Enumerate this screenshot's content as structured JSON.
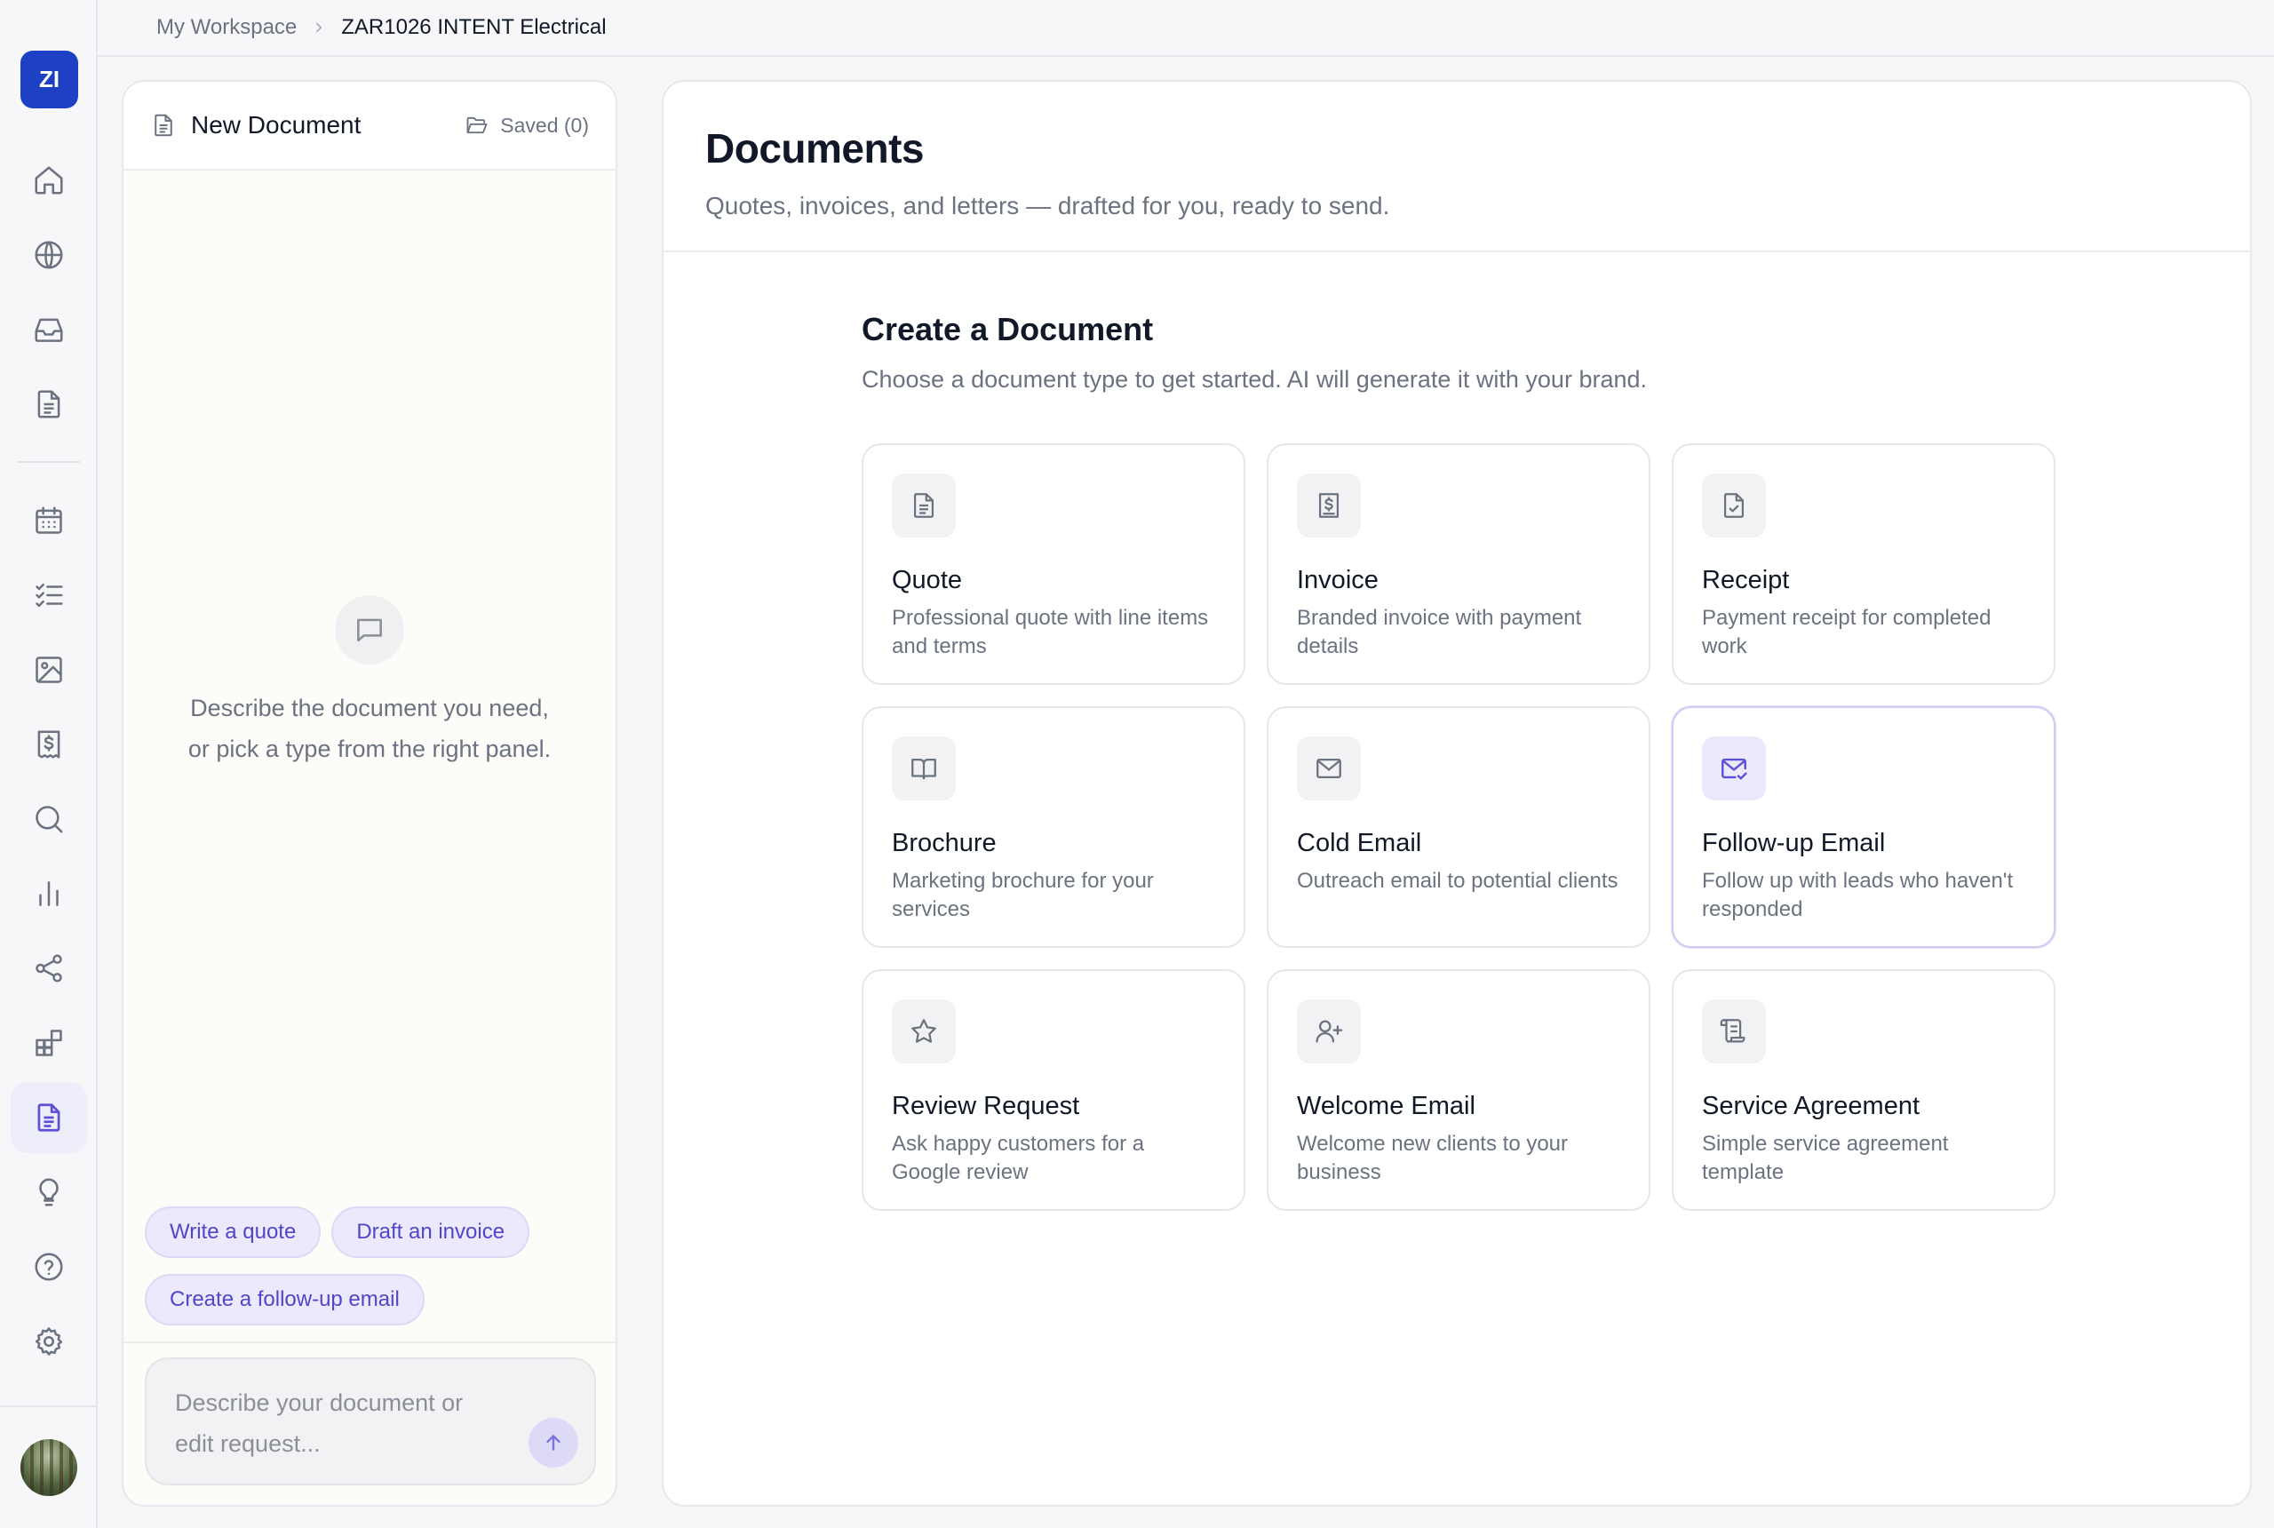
{
  "rail": {
    "workspace_badge": "ZI",
    "items": [
      {
        "name": "home-icon"
      },
      {
        "name": "globe-icon"
      },
      {
        "name": "inbox-icon"
      },
      {
        "name": "file-text-icon"
      },
      {
        "name": "calendar-icon"
      },
      {
        "name": "tasks-icon"
      },
      {
        "name": "image-icon"
      },
      {
        "name": "dollar-receipt-icon"
      },
      {
        "name": "search-icon"
      },
      {
        "name": "bar-chart-icon"
      },
      {
        "name": "share-icon"
      },
      {
        "name": "apps-icon"
      },
      {
        "name": "documents-icon",
        "active": true
      },
      {
        "name": "lightbulb-icon"
      },
      {
        "name": "help-icon"
      },
      {
        "name": "settings-icon"
      }
    ]
  },
  "breadcrumb": {
    "workspace": "My Workspace",
    "current": "ZAR1026 INTENT Electrical"
  },
  "chat": {
    "title": "New Document",
    "saved_label": "Saved (0)",
    "empty_text_line1": "Describe the document you need,",
    "empty_text_line2": "or pick a type from the right panel.",
    "chips": [
      "Write a quote",
      "Draft an invoice",
      "Create a follow-up email"
    ],
    "input_placeholder_line1": "Describe your document or",
    "input_placeholder_line2": "edit request..."
  },
  "main": {
    "title": "Documents",
    "subtitle": "Quotes, invoices, and letters — drafted for you, ready to send.",
    "section_title": "Create a Document",
    "section_subtitle": "Choose a document type to get started. AI will generate it with your brand.",
    "cards": [
      {
        "title": "Quote",
        "desc": "Professional quote with line items and terms",
        "icon": "file-lines-icon"
      },
      {
        "title": "Invoice",
        "desc": "Branded invoice with payment details",
        "icon": "invoice-dollar-icon"
      },
      {
        "title": "Receipt",
        "desc": "Payment receipt for completed work",
        "icon": "file-check-icon"
      },
      {
        "title": "Brochure",
        "desc": "Marketing brochure for your services",
        "icon": "open-book-icon"
      },
      {
        "title": "Cold Email",
        "desc": "Outreach email to potential clients",
        "icon": "mail-icon"
      },
      {
        "title": "Follow-up Email",
        "desc": "Follow up with leads who haven't responded",
        "icon": "mail-check-icon"
      },
      {
        "title": "Review Request",
        "desc": "Ask happy customers for a Google review",
        "icon": "star-icon"
      },
      {
        "title": "Welcome Email",
        "desc": "Welcome new clients to your business",
        "icon": "user-plus-icon"
      },
      {
        "title": "Service Agreement",
        "desc": "Simple service agreement template",
        "icon": "scroll-icon"
      }
    ],
    "accent_color": "#5b50d6"
  }
}
